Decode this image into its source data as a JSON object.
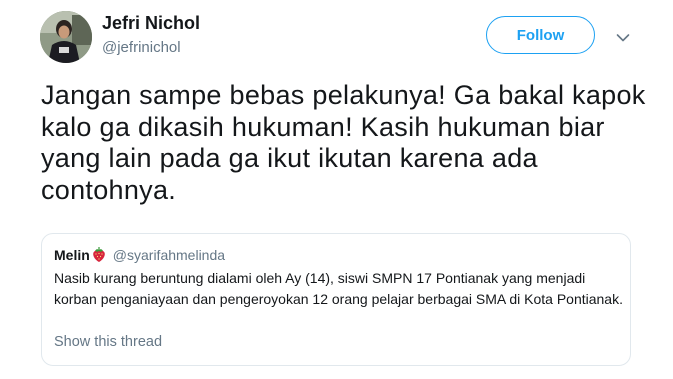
{
  "author": {
    "name": "Jefri Nichol",
    "handle": "@jefrinichol",
    "avatar_icon": "profile-photo"
  },
  "actions": {
    "follow_label": "Follow",
    "more_icon": "chevron-down-icon"
  },
  "tweet": {
    "text": "Jangan sampe bebas pelakunya! Ga bakal kapok kalo ga dikasih hukuman! Kasih hukuman biar yang lain pada ga ikut ikutan karena ada contohnya."
  },
  "quoted_tweet": {
    "name": "Melin",
    "name_emoji": "strawberry-icon",
    "handle": "@syarifahmelinda",
    "text": "Nasib kurang beruntung dialami oleh Ay (14), siswi SMPN 17 Pontianak yang menjadi korban penganiayaan dan pengeroyokan 12 orang pelajar berbagai SMA di Kota Pontianak.",
    "show_thread_label": "Show this thread"
  },
  "colors": {
    "accent": "#1da1f2",
    "text": "#14171a",
    "secondary_text": "#657786",
    "border": "#e1e8ed",
    "strawberry": "#d7263d"
  }
}
